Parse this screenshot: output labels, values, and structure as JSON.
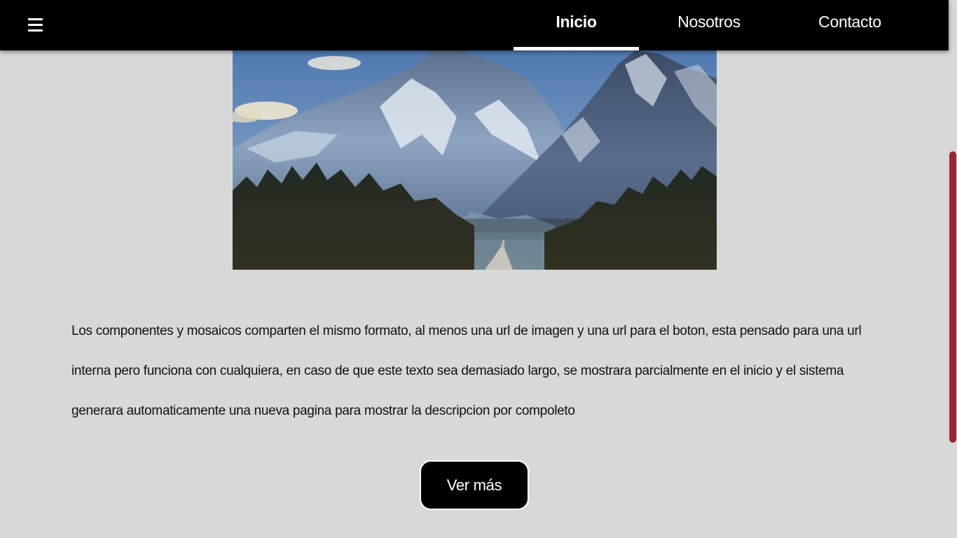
{
  "navbar": {
    "menu_icon": "hamburger-menu-icon",
    "items": [
      {
        "label": "Inicio",
        "active": true
      },
      {
        "label": "Nosotros",
        "active": false
      },
      {
        "label": "Contacto",
        "active": false
      }
    ]
  },
  "hero": {
    "image": "mountain-road-landscape"
  },
  "content": {
    "description": "Los componentes y mosaicos comparten el mismo formato, al menos una url de imagen y una url para el boton, esta pensado para una url interna pero funciona con cualquiera, en caso de que este texto sea demasiado largo, se mostrara parcialmente en el inicio y el sistema generara automaticamente una nueva pagina para mostrar la descripcion por compoleto",
    "button_label": "Ver más"
  },
  "colors": {
    "navbar_bg": "#000000",
    "page_bg": "#d8d8d8",
    "scrollbar_thumb": "#9b2632",
    "button_bg": "#000000"
  }
}
